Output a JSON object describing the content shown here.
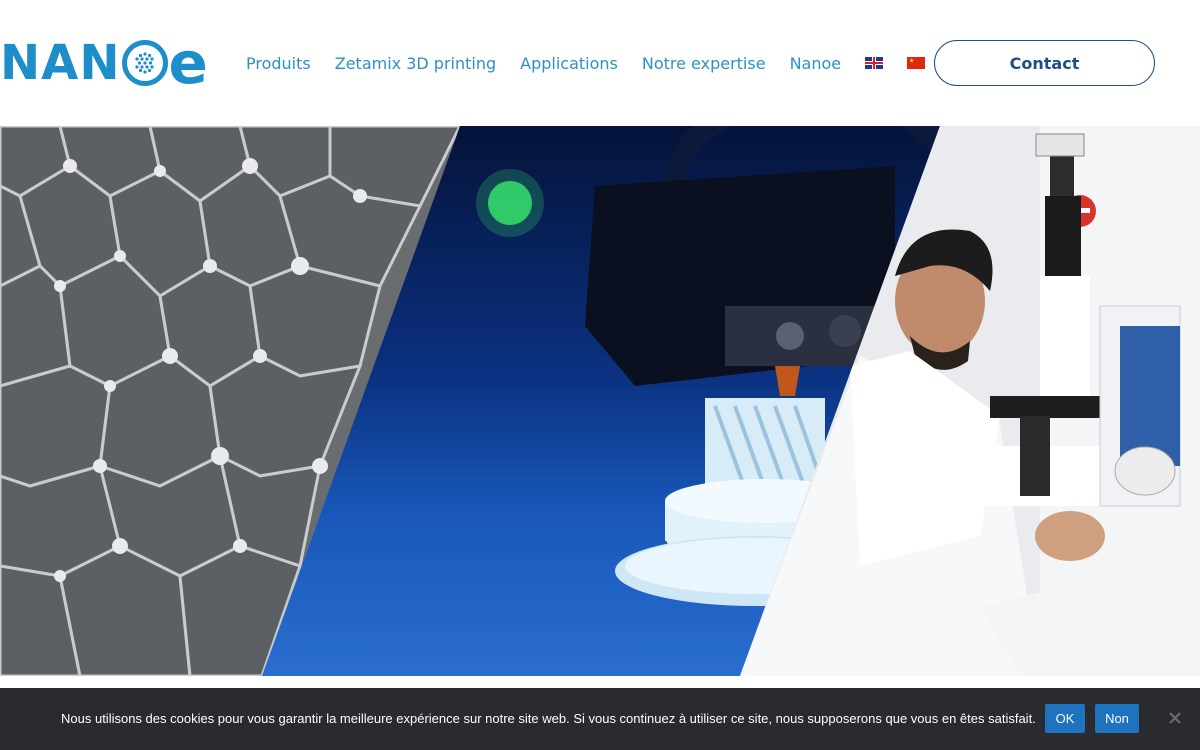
{
  "header": {
    "logo": {
      "prefix": "NAN",
      "suffix": "e",
      "icon": "nanoe-logo-o-icon",
      "color": "#1d8ec9"
    },
    "nav": [
      {
        "label": "Produits"
      },
      {
        "label": "Zetamix 3D printing"
      },
      {
        "label": "Applications"
      },
      {
        "label": "Notre expertise"
      },
      {
        "label": "Nanoe"
      }
    ],
    "flags": [
      {
        "icon": "uk-flag-icon"
      },
      {
        "icon": "china-flag-icon"
      }
    ],
    "contact_label": "Contact",
    "nav_color": "#2b92c5",
    "contact_color": "#1c4f86"
  },
  "hero": {
    "panels": [
      {
        "name": "ceramic-microstructure-image"
      },
      {
        "name": "3d-printer-image"
      },
      {
        "name": "laboratory-microscope-image"
      }
    ]
  },
  "cookie_bar": {
    "text": "Nous utilisons des cookies pour vous garantir la meilleure expérience sur notre site web. Si vous continuez à utiliser ce site, nous supposerons que vous en êtes satisfait.",
    "ok_label": "OK",
    "no_label": "Non",
    "close_icon": "close-icon",
    "background": "#2a2b2f",
    "button_color": "#1e73be"
  }
}
